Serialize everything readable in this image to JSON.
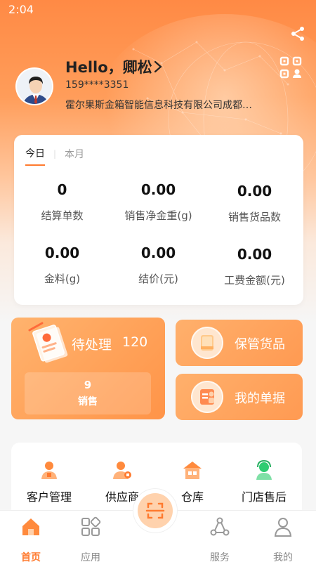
{
  "status": {
    "time": "2:04"
  },
  "user": {
    "greeting": "Hello，卿松",
    "phone": "159****3351",
    "company": "霍尔果斯金箱智能信息科技有限公司成都…"
  },
  "stats": {
    "tabs": [
      "今日",
      "本月"
    ],
    "items": [
      {
        "value": "0",
        "label": "结算单数"
      },
      {
        "value": "0.00",
        "label": "销售净金重(g)"
      },
      {
        "value": "0.00",
        "label": "销售货品数"
      },
      {
        "value": "0.00",
        "label": "金料(g)"
      },
      {
        "value": "0.00",
        "label": "结价(元)"
      },
      {
        "value": "0.00",
        "label": "工费金额(元)"
      }
    ]
  },
  "pending": {
    "title": "待处理",
    "count": "120",
    "sub_count": "9",
    "sub_label": "销售"
  },
  "side_buttons": [
    {
      "label": "保管货品"
    },
    {
      "label": "我的单据"
    }
  ],
  "menu": [
    {
      "label": "客户管理",
      "icon": "customer-icon"
    },
    {
      "label": "供应商",
      "icon": "supplier-icon"
    },
    {
      "label": "仓库",
      "icon": "warehouse-icon"
    },
    {
      "label": "门店售后",
      "icon": "after-sales-icon"
    }
  ],
  "tabbar": [
    {
      "label": "首页",
      "icon": "home-icon"
    },
    {
      "label": "应用",
      "icon": "apps-icon"
    },
    {
      "label": "服务",
      "icon": "service-icon"
    },
    {
      "label": "我的",
      "icon": "profile-icon"
    }
  ],
  "colors": {
    "accent": "#ff7a2e",
    "hero_top": "#ff8a45",
    "card_bg": "#ffffff"
  }
}
